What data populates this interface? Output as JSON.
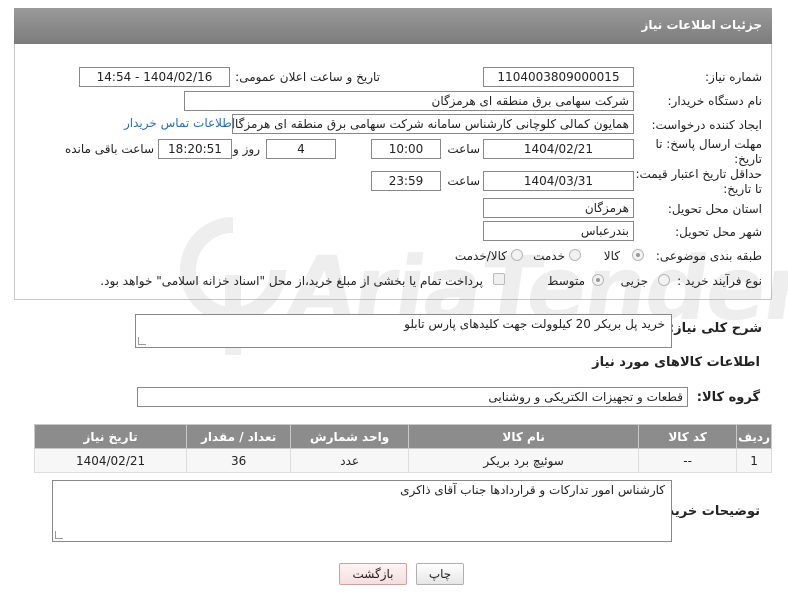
{
  "panel": {
    "title": "جزئیات اطلاعات نیاز"
  },
  "fields": {
    "need_number_label": "شماره نیاز:",
    "need_number": "1104003809000015",
    "announce_label": "تاریخ و ساعت اعلان عمومی:",
    "announce_value": "1404/02/16 - 14:54",
    "buyer_label": "نام دستگاه خریدار:",
    "buyer_value": "شرکت سهامی برق منطقه ای هرمزگان",
    "creator_label": "ایجاد کننده درخواست:",
    "creator_value": "همایون کمالی کلوچانی کارشناس سامانه شرکت سهامی برق منطقه ای هرمزگان",
    "contact_link": "اطلاعات تماس خریدار",
    "deadline_label": "مهلت ارسال پاسخ: تا تاریخ:",
    "deadline_date": "1404/02/21",
    "time_label": "ساعت",
    "deadline_time": "10:00",
    "days_value": "4",
    "days_label": "روز و",
    "remaining_time": "18:20:51",
    "remaining_label": "ساعت باقی مانده",
    "validity_label": "حداقل تاریخ اعتبار قیمت: تا تاریخ:",
    "validity_date": "1404/03/31",
    "validity_time": "23:59",
    "province_label": "استان محل تحویل:",
    "province_value": "هرمزگان",
    "city_label": "شهر محل تحویل:",
    "city_value": "بندرعباس",
    "category_label": "طبقه بندی موضوعی:",
    "category_options": [
      "کالا",
      "خدمت",
      "کالا/خدمت"
    ],
    "category_selected": "کالا",
    "process_label": "نوع فرآیند خرید :",
    "process_options": [
      "جزیی",
      "متوسط"
    ],
    "process_selected": "متوسط",
    "payment_note": "پرداخت تمام یا بخشی از مبلغ خرید،از محل \"اسناد خزانه اسلامی\" خواهد بود."
  },
  "description": {
    "label": "شرح کلی نیاز:",
    "value": "خرید پل بریکر 20 کیلوولت جهت کلیدهای پارس تابلو"
  },
  "goods_section": {
    "title": "اطلاعات کالاهای مورد نیاز",
    "group_label": "گروه کالا:",
    "group_value": "قطعات و تجهیزات الکتریکی و روشنایی"
  },
  "table": {
    "headers": [
      "ردیف",
      "کد کالا",
      "نام کالا",
      "واحد شمارش",
      "تعداد / مقدار",
      "تاریخ نیاز"
    ],
    "rows": [
      [
        "1",
        "--",
        "سوئیچ برد بریکر",
        "عدد",
        "36",
        "1404/02/21"
      ]
    ]
  },
  "buyer_notes": {
    "label": "توضیحات خریدار:",
    "value": "کارشناس امور تدارکات و قراردادها جناب آقای ذاکری"
  },
  "buttons": {
    "print": "چاپ",
    "back": "بازگشت"
  },
  "watermark": {
    "text": "AriaTender.neT"
  },
  "colors": {
    "header": "#8c8c8c",
    "link": "#2a6ebb"
  }
}
